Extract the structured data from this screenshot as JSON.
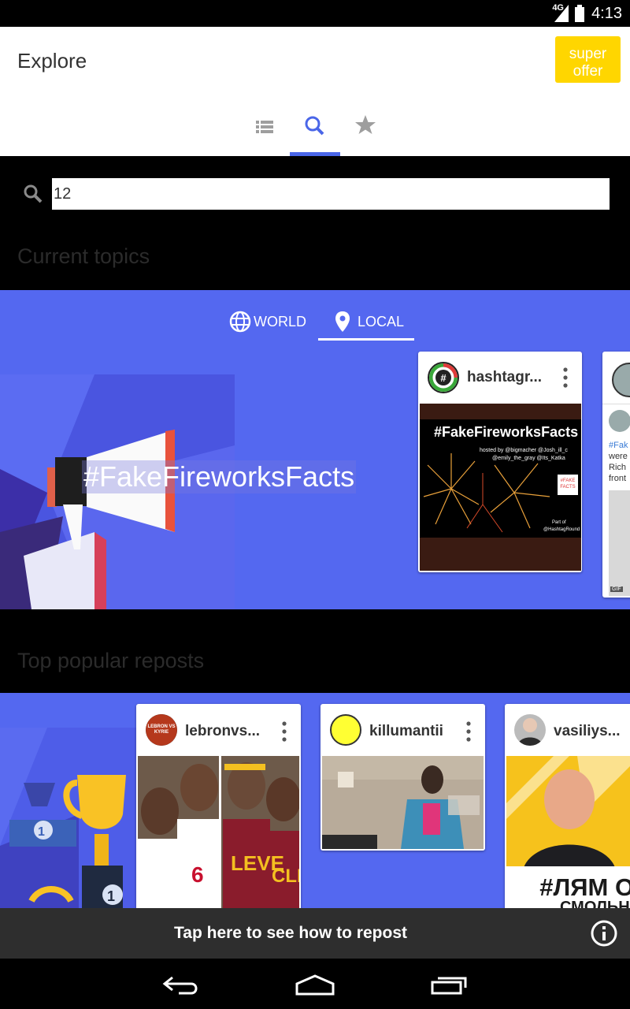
{
  "status_bar": {
    "time": "4:13",
    "network": "4G"
  },
  "header": {
    "title": "Explore",
    "offer_button": "super\noffer"
  },
  "tabs": [
    {
      "icon": "list-icon",
      "selected": false
    },
    {
      "icon": "search-icon",
      "selected": true
    },
    {
      "icon": "star-icon",
      "selected": false
    }
  ],
  "search": {
    "value": "12"
  },
  "current_topics": {
    "title": "Current topics",
    "segments": [
      {
        "label": "WORLD",
        "icon": "globe-icon",
        "selected": false
      },
      {
        "label": "LOCAL",
        "icon": "location-pin-icon",
        "selected": true
      }
    ],
    "featured_hashtag": "#FakeFireworksFacts",
    "cards": [
      {
        "username": "hashtagr...",
        "image_title": "#FakeFireworksFacts",
        "image_credits_line1": "hosted by @bigmacher @Josh_ill_c",
        "image_credits_line2": "@emily_the_gray @Its_Katka",
        "image_stamp": "#FAKE FACTS",
        "image_footer_line1": "Part of",
        "image_footer_line2": "@HashtagRound"
      },
      {
        "caption_lines": [
          "#Fak",
          "were",
          "Rich",
          "front"
        ],
        "badge": "GIF"
      }
    ]
  },
  "top_popular": {
    "title": "Top popular reposts",
    "podium_numbers": [
      "1",
      "1"
    ],
    "cards": [
      {
        "username": "lebronvs...",
        "avatar_text": "LEBRON VS KYRIE"
      },
      {
        "username": "killumantii"
      },
      {
        "username": "vasiliys...",
        "image_text_line1": "#ЛЯМ ОТ",
        "image_text_line2": "СМОЛЬНОГ"
      }
    ]
  },
  "snackbar": {
    "text": "Tap here to see how to repost"
  },
  "colors": {
    "accent": "#4a66e8",
    "band": "#5468f0",
    "offer": "#ffd600"
  }
}
